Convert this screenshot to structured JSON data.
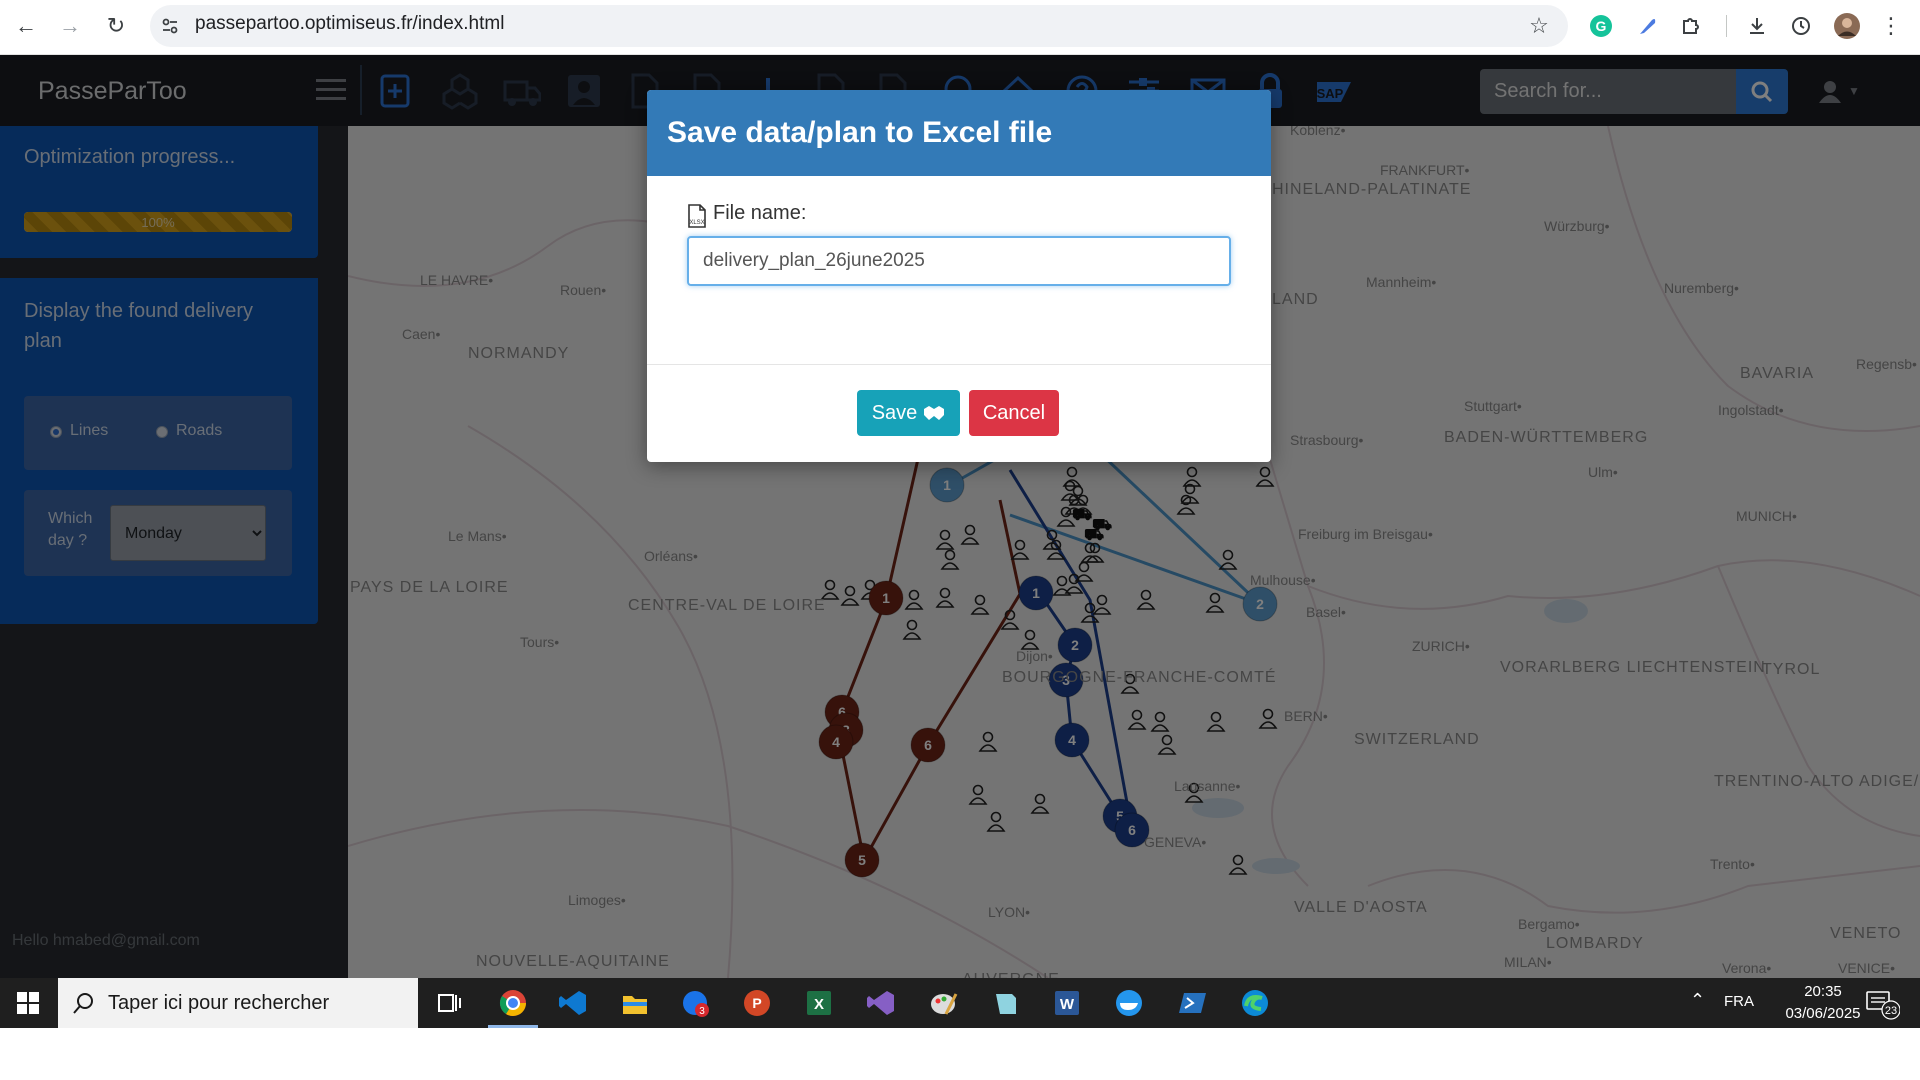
{
  "browser": {
    "url": "passepartoo.optimiseus.fr/index.html",
    "icons": [
      "back-arrow-icon",
      "forward-arrow-icon",
      "reload-icon",
      "site-info-icon",
      "bookmark-star-icon",
      "grammarly-icon",
      "feather-icon",
      "extensions-icon",
      "download-icon",
      "history-icon",
      "profile-avatar-icon",
      "more-vert-icon"
    ]
  },
  "app": {
    "brand": "PasseParToo",
    "search_placeholder": "Search for...",
    "nav_icons": [
      "plus-square-icon",
      "cubes-icon",
      "truck-icon",
      "user-id-icon",
      "document-icon",
      "document-icon",
      "pin-icon",
      "document-icon",
      "document-icon",
      "bubble-icon",
      "home-icon",
      "help-icon",
      "sliders-icon",
      "envelope-icon",
      "info-icon",
      "lock-icon",
      "sap-icon"
    ],
    "sap_label": "SAP",
    "colors": {
      "navbar": "#1a1d22",
      "panel": "#0d56b5",
      "accent": "#337ab7",
      "save": "#17a2b8",
      "cancel": "#dc3545"
    }
  },
  "sidebar": {
    "progress_title": "Optimization progress...",
    "progress_value": 100,
    "progress_label": "100%",
    "display_title": "Display the found delivery plan",
    "radio_lines": "Lines",
    "radio_roads": "Roads",
    "selected_mode": "Lines",
    "day_label": "Which day ?",
    "day_value": "Monday",
    "hello": "Hello hmabed@gmail.com"
  },
  "map": {
    "regions": [
      "NORMANDY",
      "CENTRE-VAL DE LOIRE",
      "PAYS DE LA LOIRE",
      "BOURGOGNE-FRANCHE-COMTÉ",
      "HINELAND-PALATINATE",
      "LAND",
      "BADEN-WÜRTTEMBERG",
      "BAVARIA",
      "SWITZERLAND",
      "VORARLBERG LIECHTENSTEIN",
      "TYROL",
      "TRENTINO-ALTO ADIGE/SÜDTIROL",
      "VALLE D'AOSTA",
      "LOMBARDY",
      "VENETO",
      "NOUVELLE-AQUITAINE",
      "AUVERGNE"
    ],
    "cities": [
      "LE HAVRE",
      "Rouen",
      "Caen",
      "Le Mans",
      "Orléans",
      "Tours",
      "Limoges",
      "LYON",
      "Dijon",
      "FRANKFURT",
      "Würzburg",
      "Mannheim",
      "Nuremberg",
      "Regensb",
      "Stuttgart",
      "Ingolstadt",
      "Strasbourg",
      "Ulm",
      "MUNICH",
      "Freiburg im Breisgau",
      "Mulhouse",
      "Basel",
      "ZURICH",
      "BERN",
      "Lausanne",
      "GENEVA",
      "Trento",
      "Bergamo",
      "MILAN",
      "Verona",
      "VENICE",
      "Koblenz"
    ],
    "route_marker_numbers": [
      "1",
      "2",
      "3",
      "4",
      "5",
      "6"
    ]
  },
  "modal": {
    "title": "Save data/plan to Excel file",
    "file_label": "File name:",
    "file_name": "delivery_plan_26june2025",
    "save_label": "Save",
    "cancel_label": "Cancel"
  },
  "taskbar": {
    "search_text": "Taper ici pour rechercher",
    "apps": [
      "task-view-icon",
      "chrome-icon",
      "vscode-icon",
      "file-explorer-icon",
      "outlook-icon",
      "powerpoint-icon",
      "excel-icon",
      "visual-studio-icon",
      "paint-icon",
      "notes-icon",
      "word-icon",
      "docker-icon",
      "powershell-icon",
      "edge-icon"
    ],
    "outlook_badge": "3",
    "language": "FRA",
    "time": "20:35",
    "date": "03/06/2025",
    "notification_count": "23"
  }
}
